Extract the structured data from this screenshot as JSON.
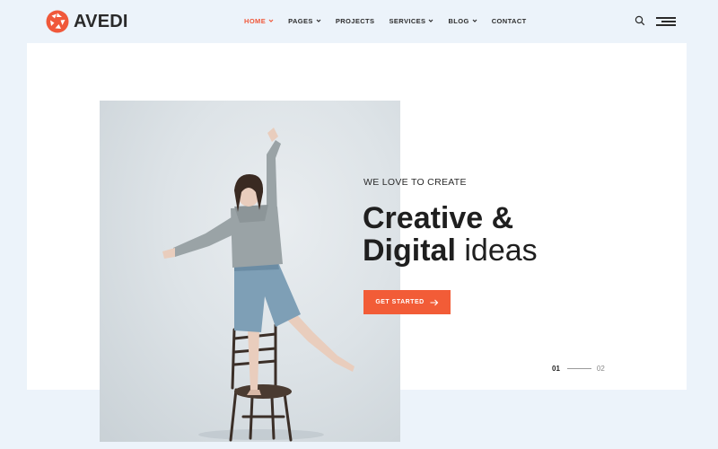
{
  "brand": {
    "name": "AVEDI",
    "accent": "#f0583a"
  },
  "nav": {
    "items": [
      {
        "label": "HOME",
        "active": true,
        "has_dropdown": true
      },
      {
        "label": "PAGES",
        "active": false,
        "has_dropdown": true
      },
      {
        "label": "PROJECTS",
        "active": false,
        "has_dropdown": false
      },
      {
        "label": "SERVICES",
        "active": false,
        "has_dropdown": true
      },
      {
        "label": "BLOG",
        "active": false,
        "has_dropdown": true
      },
      {
        "label": "CONTACT",
        "active": false,
        "has_dropdown": false
      }
    ]
  },
  "hero": {
    "eyebrow": "WE LOVE TO CREATE",
    "headline_line1": "Creative &",
    "headline_line2_bold": "Digital",
    "headline_line2_light": "ideas",
    "cta_label": "GET STARTED",
    "pager": {
      "current": "01",
      "next": "02"
    }
  },
  "icons": {
    "search": "search-icon",
    "menu": "hamburger-menu-icon",
    "cta_arrow": "arrow-right-icon"
  }
}
